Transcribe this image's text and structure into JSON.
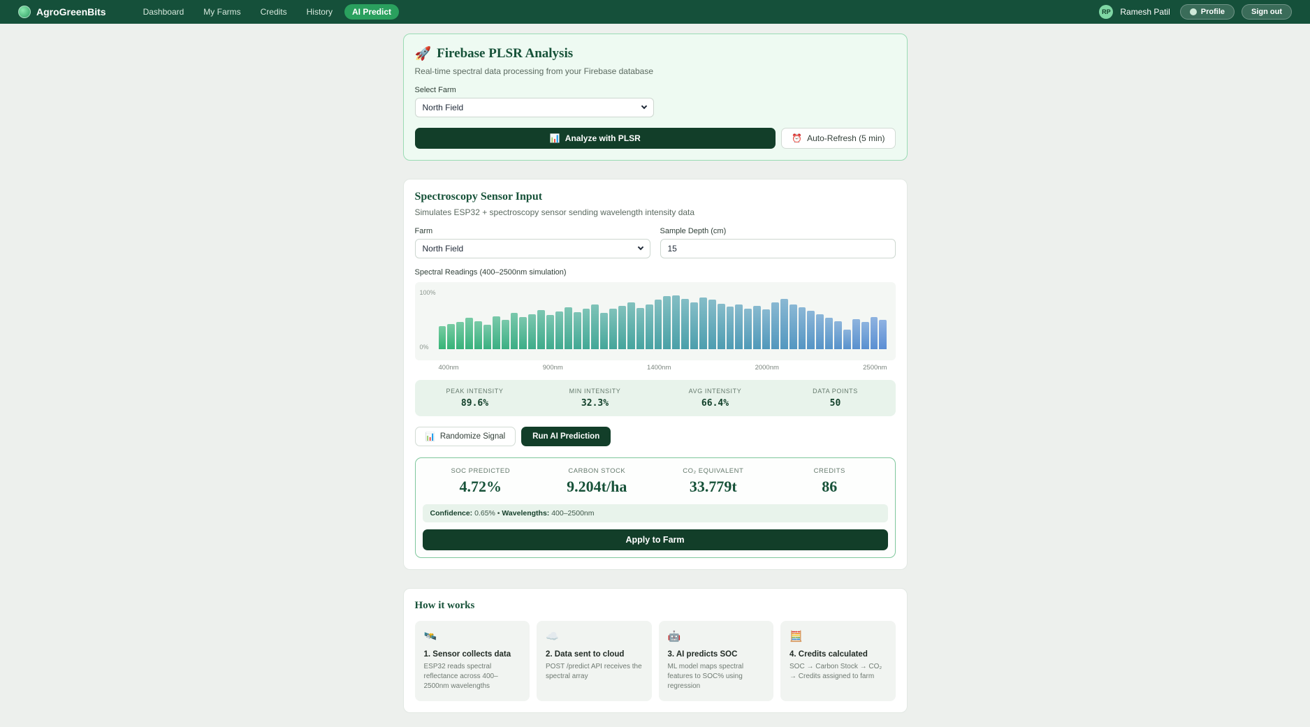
{
  "navbar": {
    "brand": "AgroGreenBits",
    "items": [
      {
        "label": "Dashboard"
      },
      {
        "label": "My Farms"
      },
      {
        "label": "Credits"
      },
      {
        "label": "History"
      },
      {
        "label": "AI Predict",
        "active": true
      }
    ],
    "user": {
      "initials": "RP",
      "name": "Ramesh Patil"
    },
    "profile_label": "Profile",
    "signout_label": "Sign out"
  },
  "plsr_card": {
    "icon": "🚀",
    "title": "Firebase PLSR Analysis",
    "subtitle": "Real-time spectral data processing from your Firebase database",
    "select_label": "Select Farm",
    "select_value": "North Field",
    "analyze_icon": "📊",
    "analyze_label": "Analyze with PLSR",
    "refresh_icon": "⏰",
    "refresh_label": "Auto-Refresh (5 min)"
  },
  "sensor_card": {
    "title": "Spectroscopy Sensor Input",
    "subtitle": "Simulates ESP32 + spectroscopy sensor sending wavelength intensity data",
    "farm_label": "Farm",
    "farm_value": "North Field",
    "depth_label": "Sample Depth (cm)",
    "depth_value": "15",
    "spectral_label": "Spectral Readings (400–2500nm simulation)",
    "stats": [
      {
        "label": "PEAK INTENSITY",
        "value": "89.6%"
      },
      {
        "label": "MIN INTENSITY",
        "value": "32.3%"
      },
      {
        "label": "AVG INTENSITY",
        "value": "66.4%"
      },
      {
        "label": "DATA POINTS",
        "value": "50"
      }
    ],
    "randomize_icon": "📊",
    "randomize_label": "Randomize Signal",
    "predict_label": "Run AI Prediction"
  },
  "results": {
    "metrics": [
      {
        "label": "SOC PREDICTED",
        "value": "4.72%"
      },
      {
        "label": "CARBON STOCK",
        "value": "9.204t/ha"
      },
      {
        "label": "CO₂ EQUIVALENT",
        "value": "33.779t"
      },
      {
        "label": "CREDITS",
        "value": "86"
      }
    ],
    "confidence_label": "Confidence:",
    "confidence_value": "0.65%",
    "separator": "•",
    "wavelengths_label": "Wavelengths:",
    "wavelengths_value": "400–2500nm",
    "apply_label": "Apply to Farm"
  },
  "how_it_works": {
    "title": "How it works",
    "steps": [
      {
        "icon": "🛰️",
        "title": "1. Sensor collects data",
        "desc": "ESP32 reads spectral reflectance across 400–2500nm wavelengths"
      },
      {
        "icon": "☁️",
        "title": "2. Data sent to cloud",
        "desc": "POST /predict API receives the spectral array"
      },
      {
        "icon": "🤖",
        "title": "3. AI predicts SOC",
        "desc": "ML model maps spectral features to SOC% using regression"
      },
      {
        "icon": "🧮",
        "title": "4. Credits calculated",
        "desc": "SOC → Carbon Stock → CO₂ → Credits assigned to farm"
      }
    ]
  },
  "chart_data": {
    "type": "bar",
    "title": "Spectral Readings (400–2500nm simulation)",
    "x_ticks": [
      "400nm",
      "900nm",
      "1400nm",
      "2000nm",
      "2500nm"
    ],
    "y_ticks": [
      "100%",
      "0%"
    ],
    "ylim": [
      0,
      100
    ],
    "unit": "% intensity",
    "values": [
      38,
      42,
      45,
      52,
      46,
      41,
      55,
      49,
      60,
      54,
      58,
      65,
      57,
      63,
      70,
      62,
      68,
      74,
      61,
      67,
      72,
      78,
      69,
      75,
      82,
      88,
      89.6,
      84,
      78,
      86,
      83,
      76,
      71,
      74,
      68,
      72,
      66,
      78,
      84,
      75,
      70,
      64,
      58,
      52,
      47,
      32.3,
      50,
      45,
      54,
      49
    ],
    "colors": {
      "start": "#36b476",
      "end": "#5b8ed4"
    }
  }
}
